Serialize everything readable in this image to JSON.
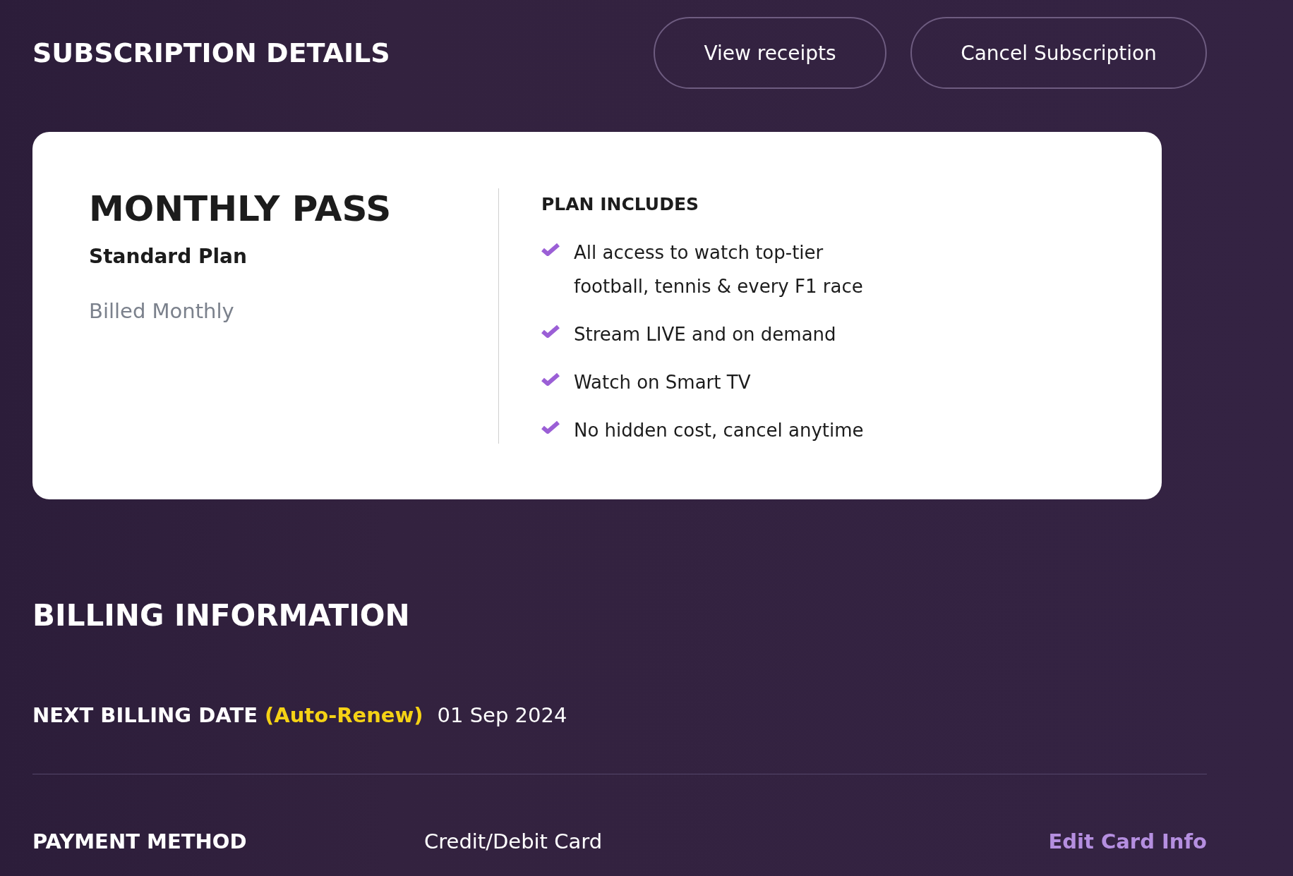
{
  "subscription": {
    "title": "SUBSCRIPTION DETAILS",
    "buttons": [
      "View receipts",
      "Cancel Subscription"
    ]
  },
  "plan_card": {
    "name": "MONTHLY PASS",
    "tier": "Standard Plan",
    "billing": "Billed Monthly",
    "includes_title": "PLAN INCLUDES",
    "features": [
      {
        "text": "All access to watch top-tier football, tennis & every F1 race"
      },
      {
        "text": "Stream LIVE and on demand"
      },
      {
        "text": "Watch on Smart TV"
      },
      {
        "text": "No hidden cost, cancel anytime"
      }
    ]
  },
  "billing": {
    "title": "BILLING INFORMATION",
    "next_billing": {
      "label": "NEXT BILLING DATE",
      "note": "(Auto-Renew)",
      "value": "01 Sep 2024"
    },
    "payment": {
      "label": "PAYMENT METHOD",
      "value": "Credit/Debit Card",
      "link": "Edit Card Info"
    }
  }
}
